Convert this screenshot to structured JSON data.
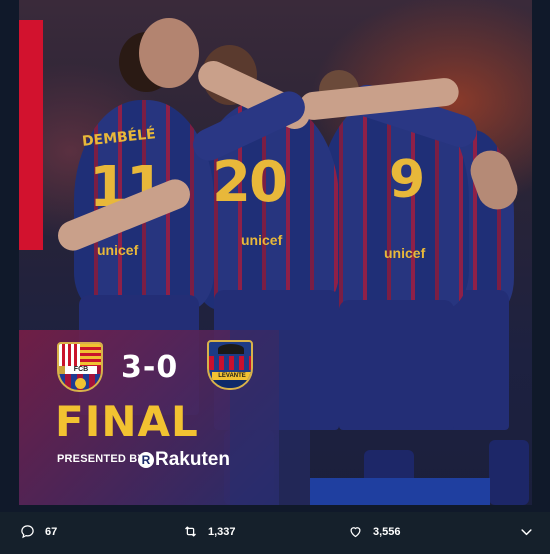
{
  "graphic": {
    "jersey_name": "DEMBÉLÉ",
    "numbers": [
      "11",
      "20",
      "9"
    ],
    "sponsor": "unicef",
    "crest_home_text": "FCB",
    "crest_away_text": "LEVANTE U.D.",
    "score": "3-0",
    "status": "FINAL",
    "presented_by": "PRESENTED BY",
    "sponsor_logo": "Rakuten",
    "colors": {
      "accent_red": "#d2122e",
      "gold": "#f2c231",
      "navy": "#1f2f77"
    }
  },
  "actions": {
    "reply_count": "67",
    "retweet_count": "1,337",
    "like_count": "3,556",
    "icons": [
      "reply-icon",
      "retweet-icon",
      "like-icon",
      "chevron-down-icon"
    ]
  }
}
